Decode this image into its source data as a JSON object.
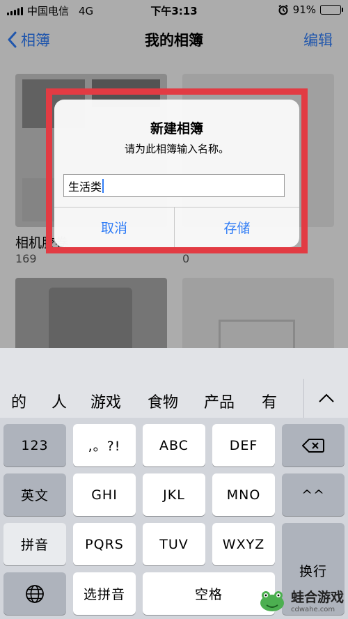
{
  "status_bar": {
    "carrier": "中国电信",
    "network": "4G",
    "time": "下午3:13",
    "battery_percent": "91%",
    "battery_level": 0.91
  },
  "nav": {
    "back_label": "相簿",
    "title": "我的相簿",
    "edit_label": "编辑"
  },
  "albums": [
    {
      "name": "相机胶卷",
      "count": "169"
    },
    {
      "name": "",
      "count": "0"
    }
  ],
  "alert": {
    "title": "新建相簿",
    "message": "请为此相簿输入名称。",
    "input_value": "生活类",
    "cancel_label": "取消",
    "save_label": "存储"
  },
  "keyboard": {
    "candidates": [
      "的",
      "人",
      "游戏",
      "食物",
      "产品",
      "有"
    ],
    "rows": {
      "r1": [
        "123",
        ",。?!",
        "ABC",
        "DEF"
      ],
      "r2": [
        "英文",
        "GHI",
        "JKL",
        "MNO",
        "^^"
      ],
      "r3": [
        "拼音",
        "PQRS",
        "TUV",
        "WXYZ"
      ],
      "r4": [
        "选拼音",
        "空格"
      ],
      "return_label": "换行"
    }
  },
  "watermark": {
    "brand": "蛙合游戏",
    "url": "cdwahe.com"
  },
  "colors": {
    "accent": "#2f7cf6",
    "highlight": "#e23b43"
  }
}
